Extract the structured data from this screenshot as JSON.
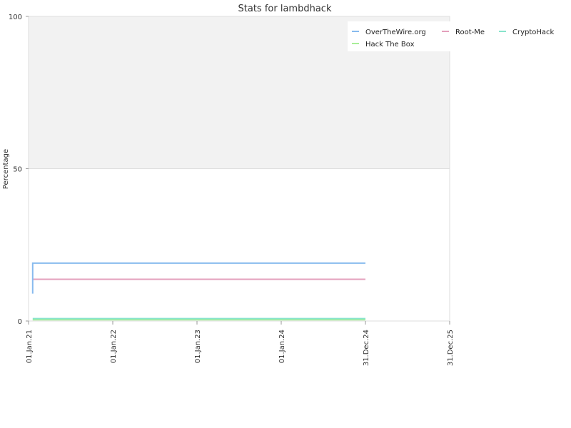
{
  "chart_data": {
    "type": "line",
    "title": "Stats for lambdhack",
    "xlabel": "",
    "ylabel": "Percentage",
    "xlim": [
      "2021-01-01",
      "2025-12-31"
    ],
    "ylim": [
      0,
      100
    ],
    "x_ticks": [
      "01.Jan.21",
      "01.Jan.22",
      "01.Jan.23",
      "01.Jan.24",
      "31.Dec.24",
      "31.Dec.25"
    ],
    "x_tick_dates": [
      "2021-01-01",
      "2022-01-01",
      "2023-01-01",
      "2024-01-01",
      "2024-12-31",
      "2025-12-31"
    ],
    "y_ticks": [
      0,
      50,
      100
    ],
    "legend_position": "top-right",
    "shaded_band": {
      "from": 50,
      "to": 100,
      "color": "#f2f2f2"
    },
    "series": [
      {
        "name": "OverTheWire.org",
        "color": "#88bbee",
        "points": [
          [
            "2021-01-19",
            9
          ],
          [
            "2021-01-19",
            19
          ],
          [
            "2024-12-31",
            19
          ]
        ]
      },
      {
        "name": "Root-Me",
        "color": "#e4a0bc",
        "points": [
          [
            "2021-01-19",
            13.7
          ],
          [
            "2024-12-31",
            13.7
          ]
        ]
      },
      {
        "name": "CryptoHack",
        "color": "#88e4cc",
        "points": [
          [
            "2021-01-19",
            0.8
          ],
          [
            "2024-12-31",
            0.8
          ]
        ]
      },
      {
        "name": "Hack The Box",
        "color": "#a8ee98",
        "points": [
          [
            "2021-01-19",
            0.4
          ],
          [
            "2024-12-31",
            0.4
          ]
        ]
      }
    ]
  }
}
